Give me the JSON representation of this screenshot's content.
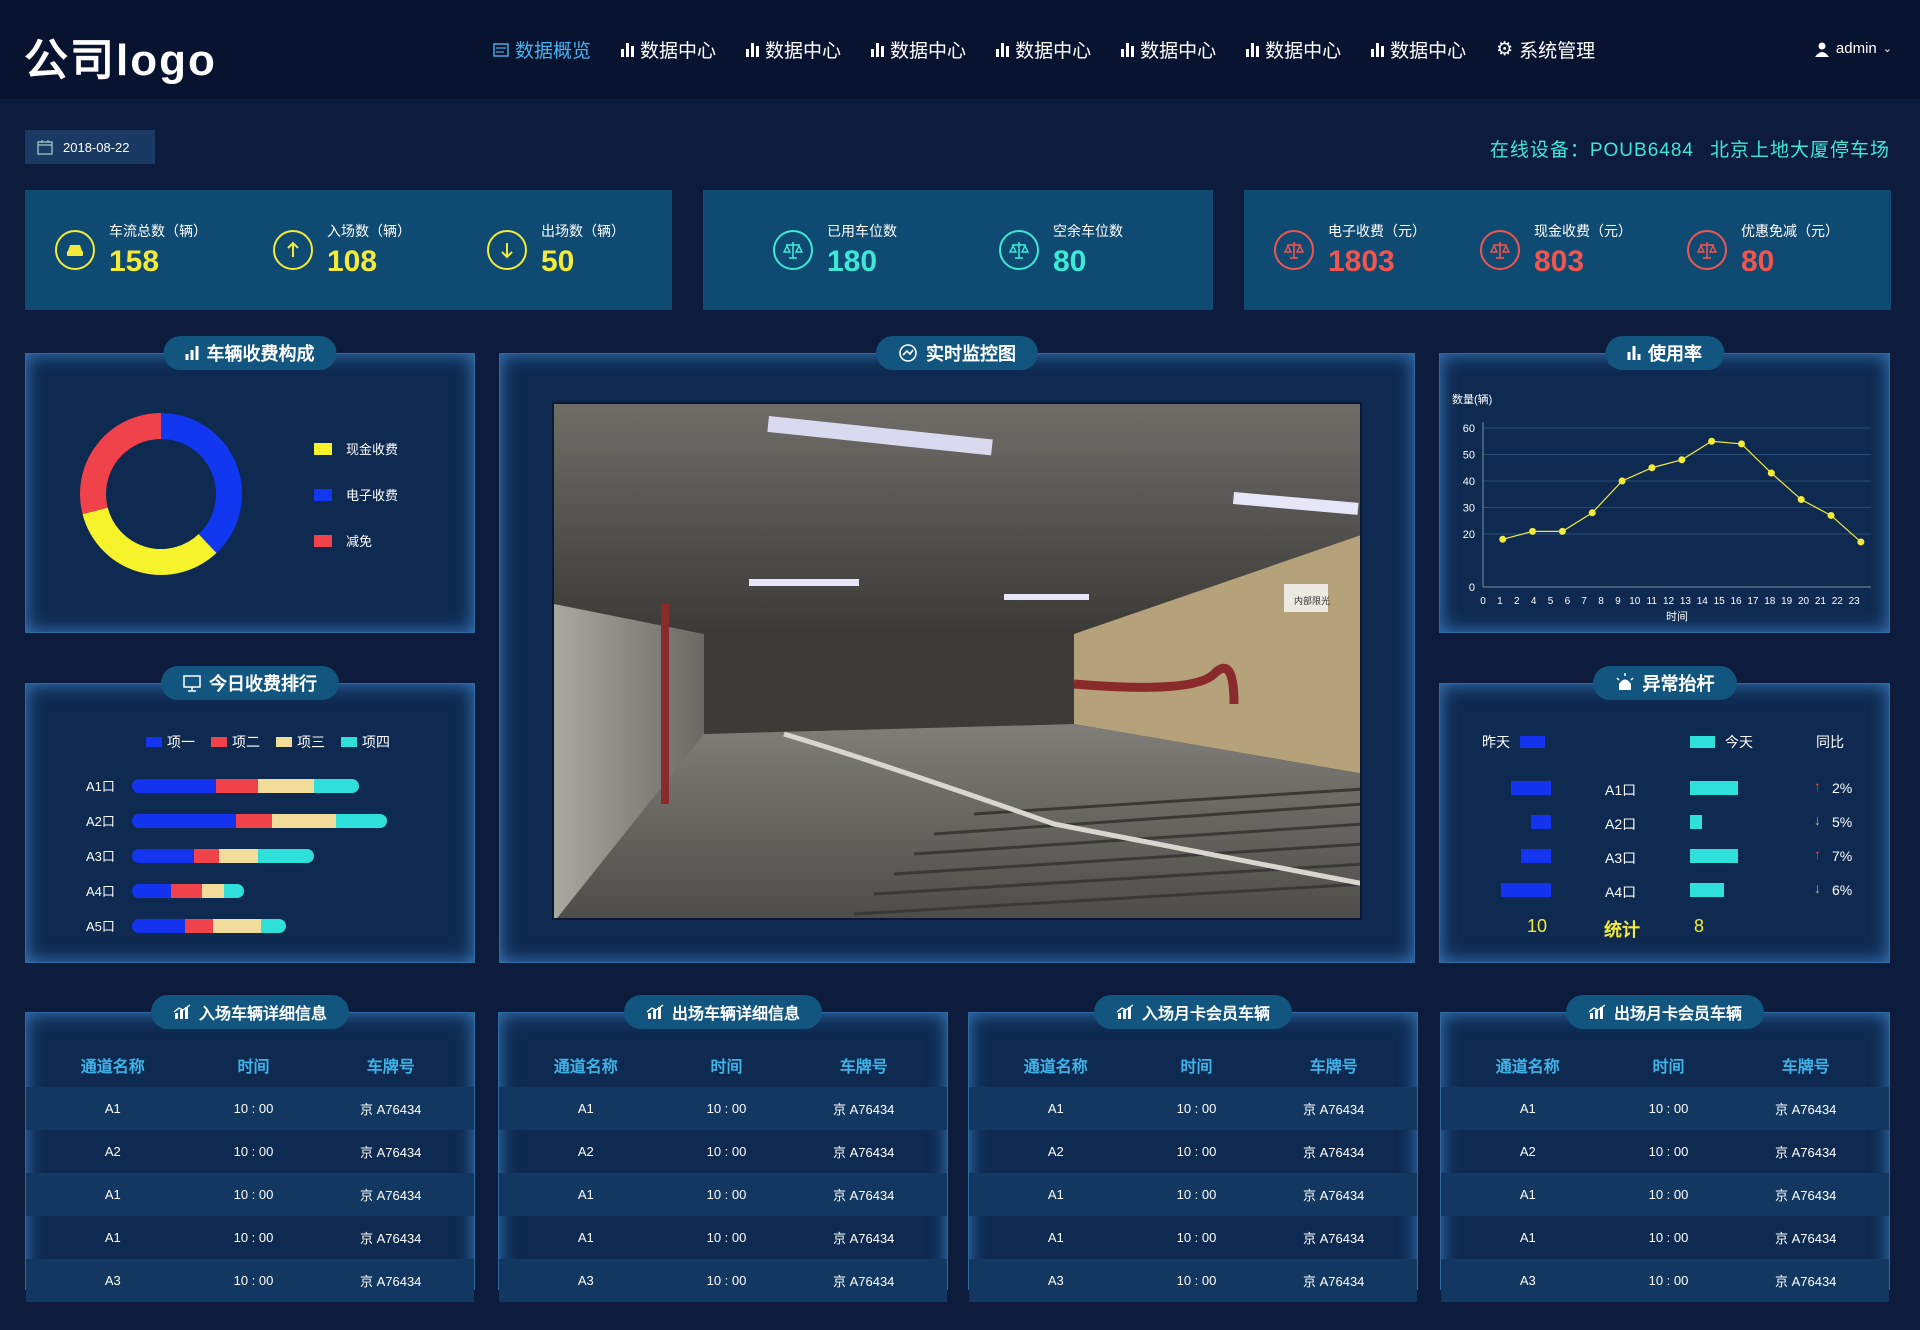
{
  "header": {
    "logo": "公司logo",
    "nav": [
      {
        "label": "数据概览",
        "icon": "document-icon",
        "active": true
      },
      {
        "label": "数据中心",
        "icon": "bar-chart-icon"
      },
      {
        "label": "数据中心",
        "icon": "bar-chart-icon"
      },
      {
        "label": "数据中心",
        "icon": "bar-chart-icon"
      },
      {
        "label": "数据中心",
        "icon": "bar-chart-icon"
      },
      {
        "label": "数据中心",
        "icon": "bar-chart-icon"
      },
      {
        "label": "数据中心",
        "icon": "bar-chart-icon"
      },
      {
        "label": "数据中心",
        "icon": "bar-chart-icon"
      },
      {
        "label": "系统管理",
        "icon": "gear-icon"
      }
    ],
    "user": "admin"
  },
  "date": "2018-08-22",
  "online": {
    "device": "在线设备：POUB6484",
    "location": "北京上地大厦停车场"
  },
  "stats": {
    "traffic": [
      {
        "label": "车流总数（辆）",
        "value": "158",
        "icon": "car-icon"
      },
      {
        "label": "入场数（辆）",
        "value": "108",
        "icon": "arrow-up-icon"
      },
      {
        "label": "出场数（辆）",
        "value": "50",
        "icon": "arrow-down-icon"
      }
    ],
    "spaces": [
      {
        "label": "已用车位数",
        "value": "180",
        "icon": "scale-icon"
      },
      {
        "label": "空余车位数",
        "value": "80",
        "icon": "scale-icon"
      }
    ],
    "fees": [
      {
        "label": "电子收费（元）",
        "value": "1803",
        "icon": "scale-icon"
      },
      {
        "label": "现金收费（元）",
        "value": "803",
        "icon": "scale-icon"
      },
      {
        "label": "优惠免减（元）",
        "value": "80",
        "icon": "scale-icon"
      }
    ],
    "colors": {
      "traffic": "#f3ea3a",
      "spaces": "#3de8d6",
      "fees": "#f0554f"
    }
  },
  "fee_composition": {
    "title": "车辆收费构成",
    "legend": [
      {
        "label": "现金收费",
        "color": "#f6f32a"
      },
      {
        "label": "电子收费",
        "color": "#1237f0"
      },
      {
        "label": "减免",
        "color": "#f0424a"
      }
    ]
  },
  "monitor": {
    "title": "实时监控图",
    "sign_text": "内部限光"
  },
  "usage": {
    "title": "使用率"
  },
  "ranking": {
    "title": "今日收费排行",
    "legend": [
      {
        "label": "项一",
        "color": "#1434f0"
      },
      {
        "label": "项二",
        "color": "#f0424a"
      },
      {
        "label": "项三",
        "color": "#f1dd99"
      },
      {
        "label": "项四",
        "color": "#2fe0da"
      }
    ],
    "rows": [
      {
        "label": "A1口",
        "values": [
          30,
          15,
          20,
          16
        ]
      },
      {
        "label": "A2口",
        "values": [
          37,
          13,
          23,
          18
        ]
      },
      {
        "label": "A3口",
        "values": [
          22,
          9,
          14,
          20
        ]
      },
      {
        "label": "A4口",
        "values": [
          14,
          11,
          8,
          7
        ]
      },
      {
        "label": "A5口",
        "values": [
          19,
          10,
          17,
          9
        ]
      }
    ]
  },
  "lift": {
    "title": "异常抬杆",
    "yesterday_label": "昨天",
    "today_label": "今天",
    "ratio_label": "同比",
    "yesterday_color": "#1434f0",
    "today_color": "#2fe0da",
    "rows": [
      {
        "label": "A1口",
        "yesterday": 0.8,
        "today": 1.0,
        "trend": "up",
        "ratio": "2%"
      },
      {
        "label": "A2口",
        "yesterday": 0.4,
        "today": 0.25,
        "trend": "down",
        "ratio": "5%"
      },
      {
        "label": "A3口",
        "yesterday": 0.6,
        "today": 1.0,
        "trend": "up",
        "ratio": "7%"
      },
      {
        "label": "A4口",
        "yesterday": 1.0,
        "today": 0.7,
        "trend": "down",
        "ratio": "6%"
      }
    ],
    "total_yesterday": "10",
    "total_label": "统计",
    "total_today": "8"
  },
  "tables": [
    {
      "title": "入场车辆详细信息"
    },
    {
      "title": "出场车辆详细信息"
    },
    {
      "title": "入场月卡会员车辆"
    },
    {
      "title": "出场月卡会员车辆"
    }
  ],
  "table_headers": [
    "通道名称",
    "时间",
    "车牌号"
  ],
  "table_rows": [
    [
      "A1",
      "10 : 00",
      "京 A76434"
    ],
    [
      "A2",
      "10 : 00",
      "京 A76434"
    ],
    [
      "A1",
      "10 : 00",
      "京 A76434"
    ],
    [
      "A1",
      "10 : 00",
      "京 A76434"
    ],
    [
      "A3",
      "10 : 00",
      "京 A76434"
    ]
  ],
  "chart_data": [
    {
      "type": "pie",
      "labels": [
        "现金收费",
        "电子收费",
        "减免"
      ],
      "values": [
        33,
        38,
        29
      ]
    },
    {
      "type": "line",
      "ylabel": "数量(辆)",
      "xlabel": "时间",
      "x": [
        0,
        1,
        2,
        3,
        4,
        5,
        6,
        7,
        8,
        9,
        10,
        11,
        12,
        13,
        14,
        15,
        16,
        17,
        18,
        19,
        20,
        21,
        22,
        23
      ],
      "x_ticks": [
        0,
        1,
        2,
        4,
        5,
        6,
        7,
        8,
        9,
        10,
        11,
        12,
        13,
        14,
        15,
        16,
        17,
        18,
        19,
        20,
        21,
        22,
        23
      ],
      "points": [
        [
          1,
          18
        ],
        [
          2,
          21
        ],
        [
          3,
          21
        ],
        [
          4,
          28
        ],
        [
          5,
          40
        ],
        [
          6,
          45
        ],
        [
          7,
          48
        ],
        [
          8,
          55
        ],
        [
          9,
          54
        ],
        [
          10,
          43
        ],
        [
          11,
          33
        ],
        [
          12,
          27
        ],
        [
          13,
          17
        ]
      ],
      "point_x": [
        "1",
        "2",
        "4",
        "6",
        "8",
        "10",
        "12",
        "14",
        "16",
        "18",
        "20",
        "21",
        "23"
      ],
      "yticks": [
        0,
        20,
        30,
        40,
        50,
        60
      ],
      "grid": true
    }
  ]
}
